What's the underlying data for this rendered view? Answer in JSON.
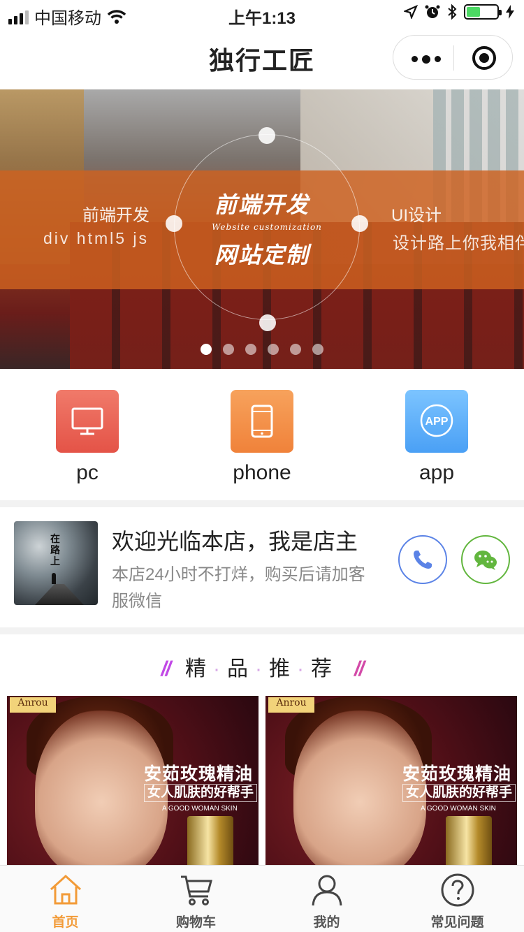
{
  "status": {
    "carrier": "中国移动",
    "time": "上午1:13",
    "battery_level": 0.45
  },
  "nav": {
    "title": "独行工匠"
  },
  "banner": {
    "left_title": "前端开发",
    "left_sub": "div  html5  js",
    "center_title": "前端开发",
    "center_sub": "Website customization",
    "center_title2": "网站定制",
    "right_title": "UI设计",
    "right_sub": "设计路上你我相伴",
    "slide_count": 6,
    "active_slide": 1
  },
  "categories": [
    {
      "label": "pc",
      "icon": "monitor-icon",
      "color": "#e9594c"
    },
    {
      "label": "phone",
      "icon": "phone-icon",
      "color": "#f2893f"
    },
    {
      "label": "app",
      "icon": "app-icon",
      "color": "#55a8f7",
      "badge": "APP"
    }
  ],
  "owner": {
    "title": "欢迎光临本店，我是店主",
    "desc": "本店24小时不打烊，购买后请加客服微信",
    "avatar_text": "在路上"
  },
  "recommend": {
    "heading": [
      "精",
      "品",
      "推",
      "荐"
    ],
    "products": [
      {
        "brand": "Anrou",
        "title": "安茹玫瑰精油",
        "subtitle": "女人肌肤的好帮手",
        "tagline": "A GOOD WOMAN SKIN"
      },
      {
        "brand": "Anrou",
        "title": "安茹玫瑰精油",
        "subtitle": "女人肌肤的好帮手",
        "tagline": "A GOOD WOMAN SKIN"
      }
    ]
  },
  "tabs": [
    {
      "label": "首页",
      "icon": "home-icon",
      "active": true
    },
    {
      "label": "购物车",
      "icon": "cart-icon",
      "active": false
    },
    {
      "label": "我的",
      "icon": "user-icon",
      "active": false
    },
    {
      "label": "常见问题",
      "icon": "question-icon",
      "active": false
    }
  ],
  "colors": {
    "accent": "#f29b38",
    "banner_band": "#ce6220",
    "phone_btn": "#5b83e6",
    "wechat_btn": "#62b63e"
  }
}
